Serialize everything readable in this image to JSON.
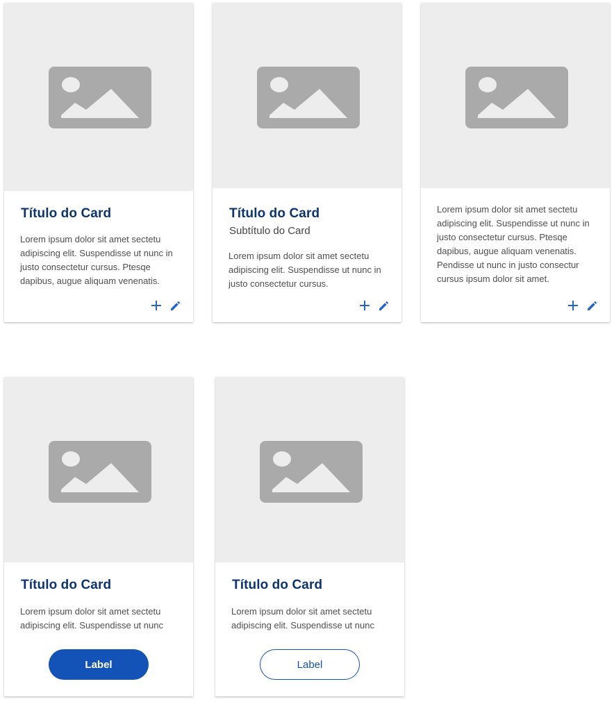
{
  "colors": {
    "title": "#0b3474",
    "accent": "#2364d2",
    "button": "#1352b6",
    "media_bg": "#ededed",
    "placeholder": "#aaaaaa"
  },
  "cards": [
    {
      "title": "Título do Card",
      "body": "Lorem ipsum dolor sit amet sectetu adipiscing elit. Suspendisse ut nunc in justo consectetur cursus. Ptesqe dapibus, augue aliquam venenatis.",
      "actions": [
        "plus-icon",
        "pencil-icon"
      ]
    },
    {
      "title": "Título do Card",
      "subtitle": "Subtítulo do Card",
      "body": "Lorem ipsum dolor sit amet sectetu adipiscing elit. Suspendisse ut nunc in justo consectetur cursus.",
      "actions": [
        "plus-icon",
        "pencil-icon"
      ]
    },
    {
      "body": "Lorem ipsum dolor sit amet sectetu adipiscing elit. Suspendisse ut nunc in justo consectetur cursus. Ptesqe dapibus, augue aliquam venenatis. Pendisse ut nunc in justo consectur cursus ipsum dolor sit amet.",
      "actions": [
        "plus-icon",
        "pencil-icon"
      ]
    },
    {
      "title": "Título do Card",
      "body": "Lorem ipsum dolor sit amet sectetu adipiscing elit. Suspendisse ut nunc",
      "button_label": "Label",
      "button_style": "filled"
    },
    {
      "title": "Título do Card",
      "body": "Lorem ipsum dolor sit amet sectetu adipiscing elit. Suspendisse ut nunc",
      "button_label": "Label",
      "button_style": "outlined"
    }
  ]
}
